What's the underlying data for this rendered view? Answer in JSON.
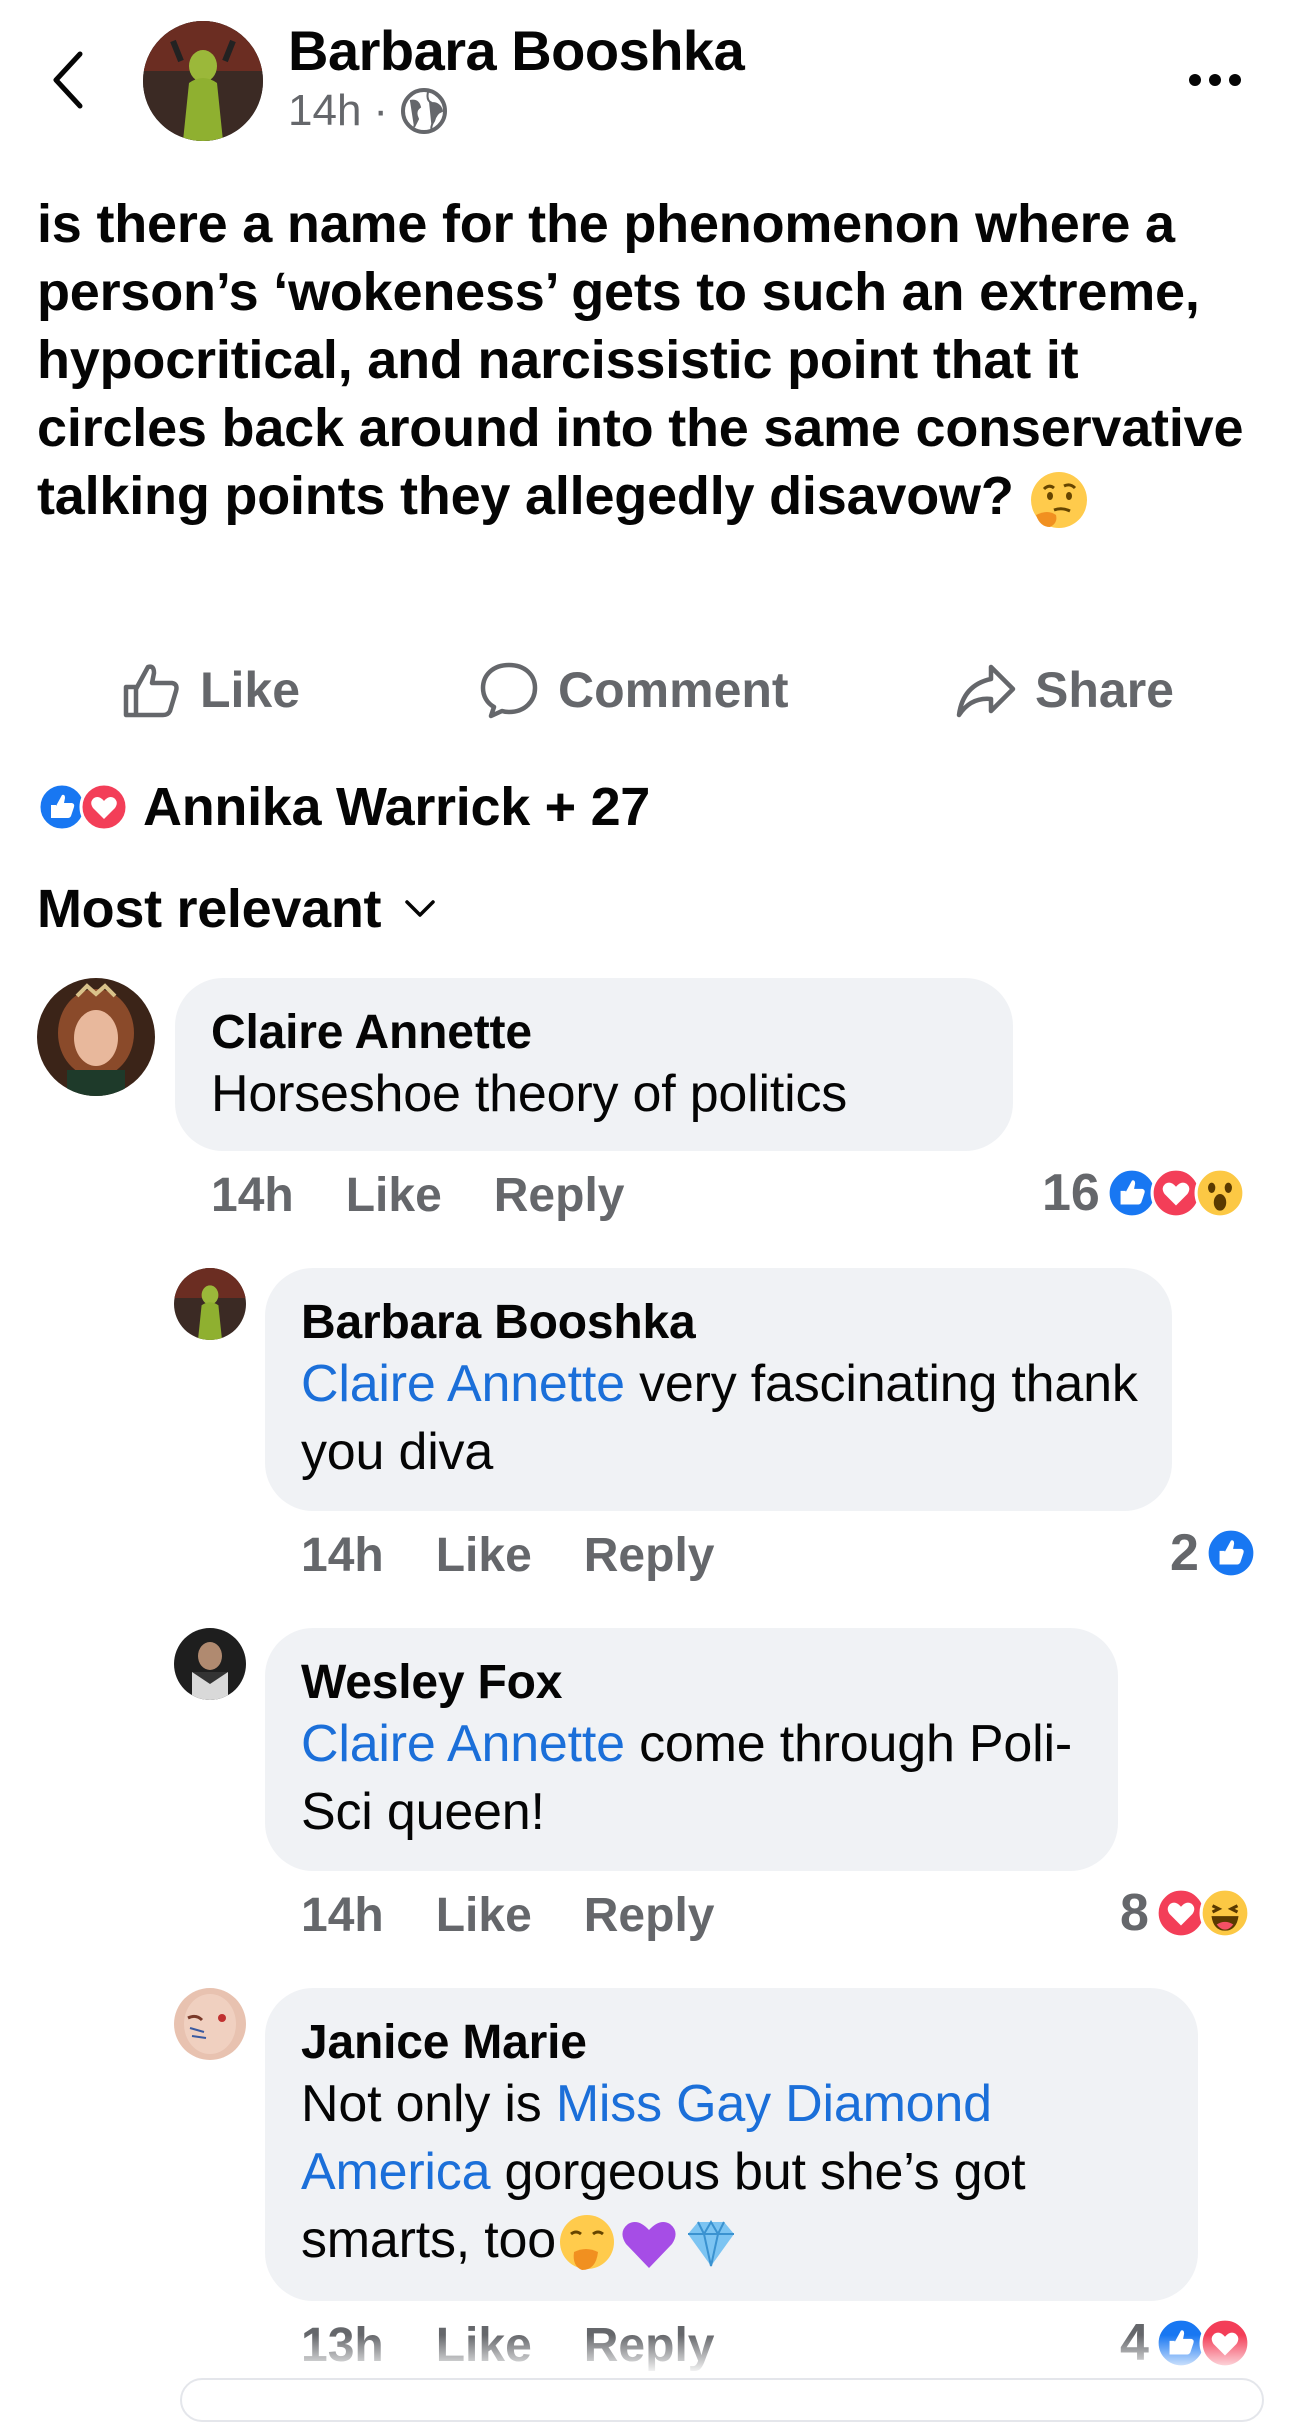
{
  "post": {
    "author": "Barbara Booshka",
    "time": "14h",
    "separator": "·",
    "text": "is there a name for the phenomenon where a person’s ‘wokeness’ gets to such an extreme, hypocritical, and narcissistic point that it circles back around into the same conservative talking points they allegedly disavow?"
  },
  "actions": {
    "like": "Like",
    "comment": "Comment",
    "share": "Share"
  },
  "reactions": {
    "summary": "Annika Warrick + 27"
  },
  "sort": {
    "label": "Most relevant"
  },
  "comments": [
    {
      "name": "Claire Annette",
      "text": "Horseshoe theory of politics",
      "time": "14h",
      "like": "Like",
      "reply": "Reply",
      "count": "16"
    },
    {
      "name": "Barbara Booshka",
      "mention": "Claire Annette",
      "text": " very fascinating thank you diva",
      "time": "14h",
      "like": "Like",
      "reply": "Reply",
      "count": "2"
    },
    {
      "name": "Wesley Fox",
      "mention": "Claire Annette",
      "text": " come through Poli-Sci queen!",
      "time": "14h",
      "like": "Like",
      "reply": "Reply",
      "count": "8"
    },
    {
      "name": "Janice Marie",
      "pre": "Not only is ",
      "mention": "Miss Gay Diamond America",
      "text": " gorgeous but she’s got smarts, too",
      "time": "13h",
      "like": "Like",
      "reply": "Reply",
      "count": "4"
    }
  ],
  "colors": {
    "accent": "#1b6fd9",
    "like_blue": "#1877f2",
    "love_red": "#f33e58",
    "muted": "#65676b",
    "bubble": "#f0f2f5"
  },
  "icons": [
    "back-icon",
    "globe-icon",
    "more-icon",
    "like-outline-icon",
    "comment-icon",
    "share-icon",
    "like-reaction-icon",
    "love-reaction-icon",
    "wow-reaction-icon",
    "haha-reaction-icon",
    "chevron-down-icon",
    "thinking-emoji",
    "face-hand-emoji",
    "purple-heart-emoji",
    "gem-emoji"
  ]
}
